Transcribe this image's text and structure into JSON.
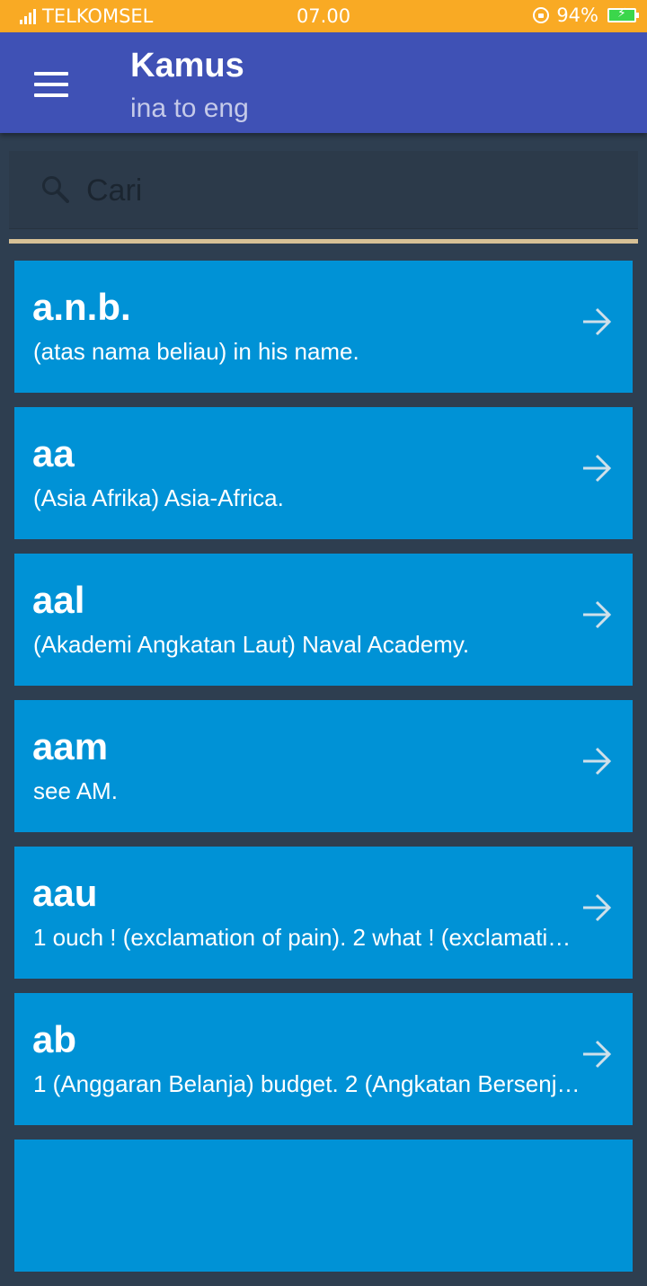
{
  "status_bar": {
    "carrier": "TELKOMSEL",
    "time": "07.00",
    "battery": "94%",
    "icons": [
      "signal-icon",
      "rotation-lock-icon",
      "battery-charging-icon"
    ]
  },
  "app_bar": {
    "title": "Kamus",
    "subtitle": "ina to eng",
    "icon": "menu-icon"
  },
  "search": {
    "placeholder": "Cari",
    "value": "",
    "icon": "search-icon"
  },
  "entries": [
    {
      "word": "a.n.b.",
      "definition": "(atas nama beliau) in his name."
    },
    {
      "word": "aa",
      "definition": "(Asia Afrika)  Asia-Africa."
    },
    {
      "word": "aal",
      "definition": "(Akademi Angkatan Laut) Naval Academy."
    },
    {
      "word": "aam",
      "definition": "see AM."
    },
    {
      "word": "aau",
      "definition": "1 ouch ! (exclamation of pain). 2 what ! (exclamati…"
    },
    {
      "word": "ab",
      "definition": "1 (Anggaran Belanja)  budget. 2 (Angkatan Bersenj…"
    }
  ],
  "colors": {
    "status_bar": "#f9aa24",
    "app_bar": "#3f51b5",
    "background": "#2e3e50",
    "card": "#0092d6",
    "divider": "#d7c196"
  }
}
